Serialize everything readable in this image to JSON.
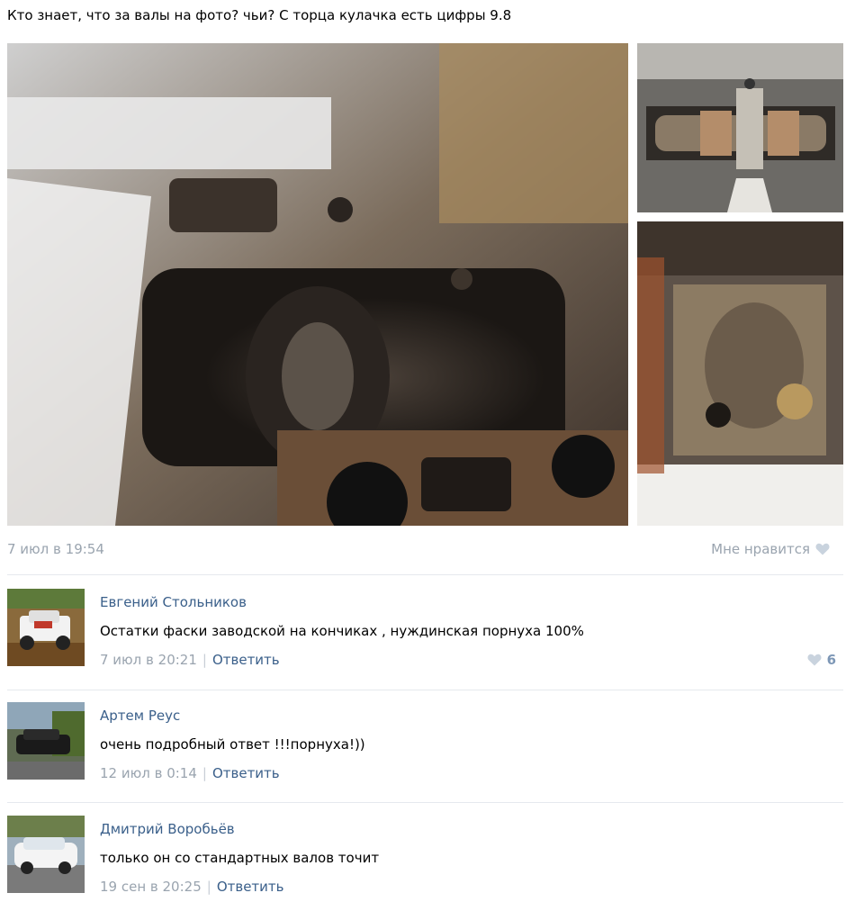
{
  "post": {
    "text": "Кто знает, что за валы на фото? чьи? С торца кулачка есть цифры 9.8",
    "date": "7 июл в 19:54",
    "like_label": "Мне нравится"
  },
  "comments": [
    {
      "author": "Евгений Стольников",
      "text": "Остатки фаски заводской на кончиках , нуждинская порнуха 100%",
      "date": "7 июл в 20:21",
      "reply_label": "Ответить",
      "likes": "6"
    },
    {
      "author": "Артем Реус",
      "text": "очень подробный ответ !!!порнуха!))",
      "date": "12 июл в 0:14",
      "reply_label": "Ответить"
    },
    {
      "author": "Дмитрий Воробьёв",
      "text": "только он со стандартных валов точит",
      "date": "19 сен в 20:25",
      "reply_label": "Ответить"
    }
  ],
  "colors": {
    "link": "#3a5f8a",
    "meta": "#9aa4af",
    "divider": "#e6e9ee"
  },
  "icons": {
    "like": "heart-icon"
  }
}
